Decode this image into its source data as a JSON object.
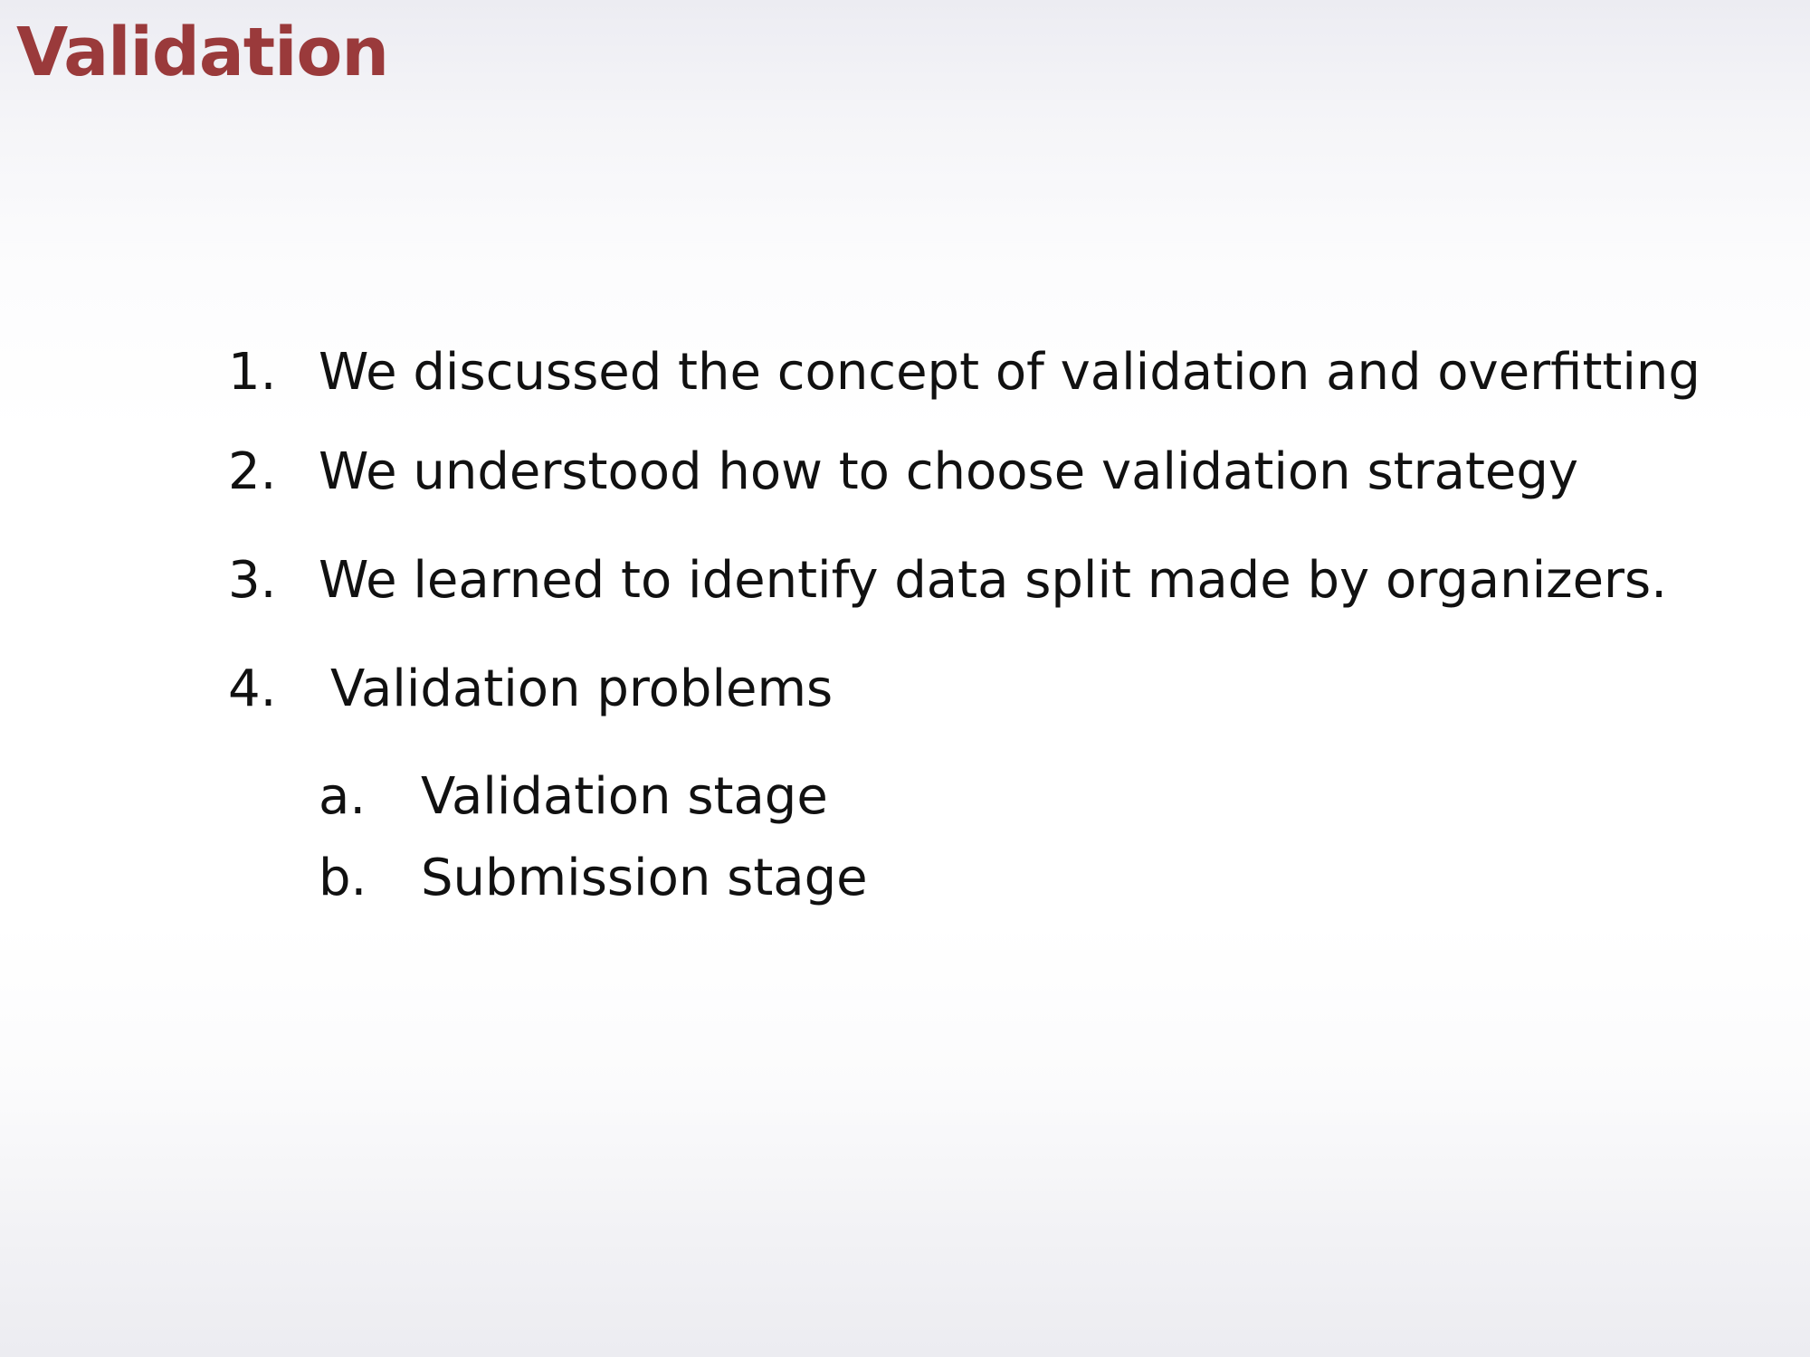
{
  "slide": {
    "title": "Validation",
    "title_color": "#9a3a3b",
    "items": [
      {
        "marker": "1.",
        "text": "We discussed the concept of validation and overfitting"
      },
      {
        "marker": "2.",
        "text": "We understood how to choose validation strategy"
      },
      {
        "marker": "3.",
        "text": "We learned to identify data split made by organizers."
      },
      {
        "marker": "4.",
        "text": "Validation problems",
        "subitems": [
          {
            "marker": "a.",
            "text": "Validation stage"
          },
          {
            "marker": "b.",
            "text": "Submission stage"
          }
        ]
      }
    ]
  }
}
